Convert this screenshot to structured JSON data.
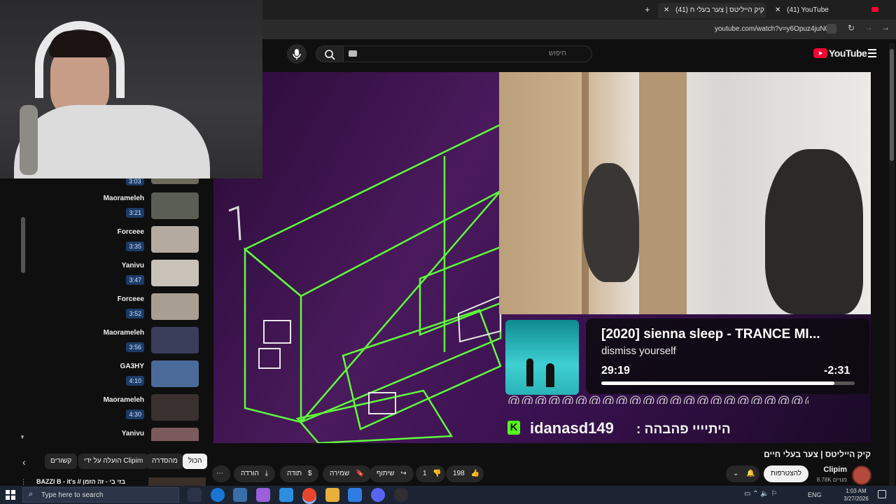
{
  "browser": {
    "tabs": [
      {
        "label": "(41) YouTube",
        "active": false
      },
      {
        "label": "(41) קיק הייליטס | צער בעלי ח",
        "active": true
      }
    ],
    "address": "youtube.com/watch?v=y6Opuz4juN0"
  },
  "youtube": {
    "logo": "YouTube",
    "search_placeholder": "חיפוש"
  },
  "sidebar": {
    "items": [
      {
        "channel": "Maorameleh",
        "duration": "3:21",
        "thumb": "#5a5e54"
      },
      {
        "channel": "Forceee",
        "duration": "3:35",
        "thumb": "#b5aaa0"
      },
      {
        "channel": "Yanivu",
        "duration": "3:47",
        "thumb": "#c8c2b8"
      },
      {
        "channel": "Forceee",
        "duration": "3:52",
        "thumb": "#a89e92"
      },
      {
        "channel": "Maorameleh",
        "duration": "3:56",
        "thumb": "#3a3e5a"
      },
      {
        "channel": "GA3HY",
        "duration": "4:10",
        "thumb": "#4a6a9a"
      },
      {
        "channel": "Maorameleh",
        "duration": "4:30",
        "thumb": "#3a3030"
      },
      {
        "channel": "Yanivu",
        "duration": "",
        "thumb": "#7a5a5a"
      }
    ],
    "partial_duration": "3:03"
  },
  "chips": [
    "הכול",
    "מהסדרה",
    "הועלה על ידי Clipim",
    "קשורים"
  ],
  "below_list_title": "BAZZI B - it's // בזי בי - זה הזמן",
  "video": {
    "title": "קיק הייליטס | צער בעלי חיים",
    "channel": "Clipim",
    "subscribers": "8.78K מנויים",
    "subscribe_label": "להצטרפות",
    "likes": "198",
    "dislikes": "1",
    "share": "שיתוף",
    "save": "שמירה",
    "thanks": "תודה",
    "download": "הורדה"
  },
  "overlay": {
    "song_title": "[2020] sienna sleep - TRANCE MI...",
    "artist": "dismiss yourself",
    "elapsed": "29:19",
    "remaining": "-2:31",
    "progress": 0.92,
    "chat_user": "idanasd149",
    "chat_text": "היתיייי פהבהה :"
  },
  "taskbar": {
    "search_placeholder": "Type here to search",
    "lang": "ENG",
    "time": "1:03 AM",
    "date": "3/27/2026"
  },
  "colors": {
    "accent": "#ff0033",
    "wire": "#5dff3a",
    "pill": "#272727"
  }
}
